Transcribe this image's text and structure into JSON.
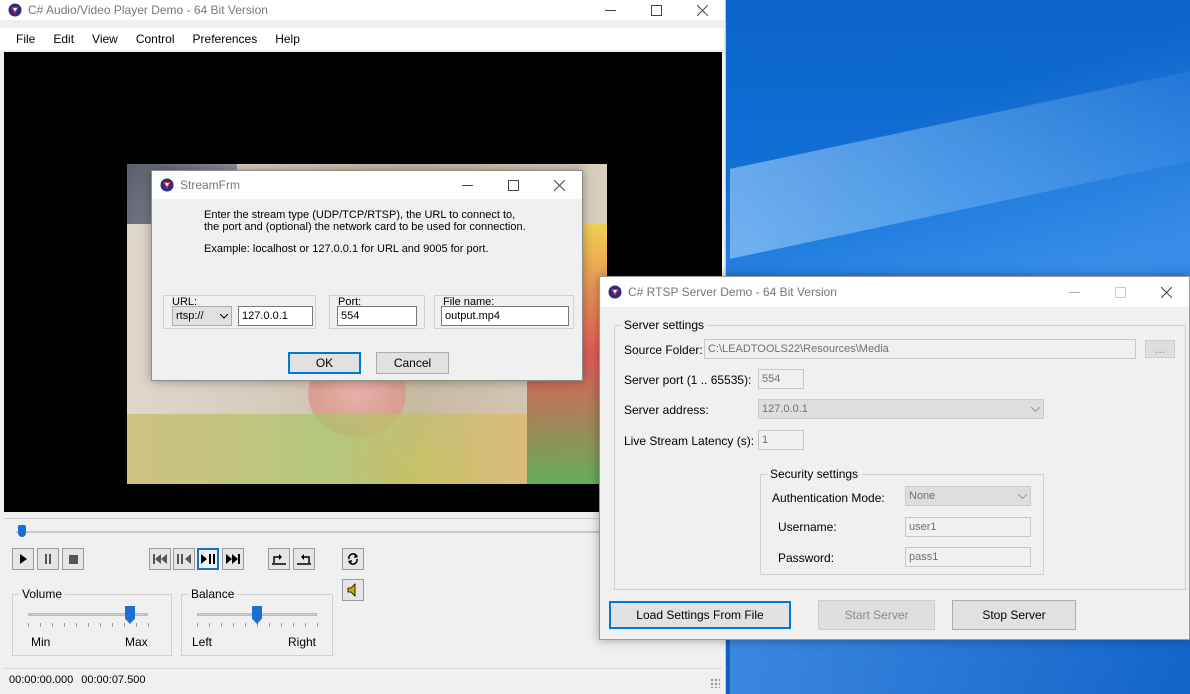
{
  "player": {
    "title": "C# Audio/Video Player Demo - 64 Bit Version",
    "menu": [
      "File",
      "Edit",
      "View",
      "Control",
      "Preferences",
      "Help"
    ],
    "volume_label": "Volume",
    "volume_min": "Min",
    "volume_max": "Max",
    "volume_level": 0.85,
    "balance_label": "Balance",
    "balance_left": "Left",
    "balance_right": "Right",
    "balance_level": 0.5,
    "seek_position": 0.0,
    "time_current": "00:00:00.000",
    "time_total": "00:00:07.500",
    "icons": {
      "play": "play-icon",
      "pause": "pause-icon",
      "stop": "stop-icon",
      "first": "skip-to-start-icon",
      "step_back": "step-back-icon",
      "step_fwd": "step-forward-icon",
      "last": "skip-to-end-icon",
      "mark_in": "mark-in-icon",
      "mark_out": "mark-out-icon",
      "loop": "loop-icon",
      "speaker": "speaker-icon"
    }
  },
  "stream_dialog": {
    "title": "StreamFrm",
    "desc_line1": "Enter the stream type (UDP/TCP/RTSP), the URL to connect to,",
    "desc_line2": "the port and (optional) the network card to be used for connection.",
    "example": "Example: localhost or 127.0.0.1 for URL and 9005 for port.",
    "url_label": "URL:",
    "protocol": "rtsp://",
    "url_value": "127.0.0.1",
    "port_label": "Port:",
    "port_value": "554",
    "file_label": "File name:",
    "file_value": "output.mp4",
    "ok": "OK",
    "cancel": "Cancel"
  },
  "rtsp": {
    "title": "C# RTSP Server Demo - 64 Bit Version",
    "server_settings": "Server settings",
    "source_folder_label": "Source Folder:",
    "source_folder_value": "C:\\LEADTOOLS22\\Resources\\Media",
    "browse": "...",
    "port_label": "Server port (1 .. 65535):",
    "port_value": "554",
    "address_label": "Server address:",
    "address_value": "127.0.0.1",
    "latency_label": "Live Stream Latency (s):",
    "latency_value": "1",
    "security_settings": "Security settings",
    "auth_label": "Authentication Mode:",
    "auth_value": "None",
    "username_label": "Username:",
    "username_value": "user1",
    "password_label": "Password:",
    "password_value": "pass1",
    "load_btn": "Load Settings From File",
    "start_btn": "Start Server",
    "stop_btn": "Stop Server"
  },
  "colors": {
    "accent": "#1a6fd0",
    "desktop": "#0a63c9",
    "video_bg": "#000000"
  }
}
